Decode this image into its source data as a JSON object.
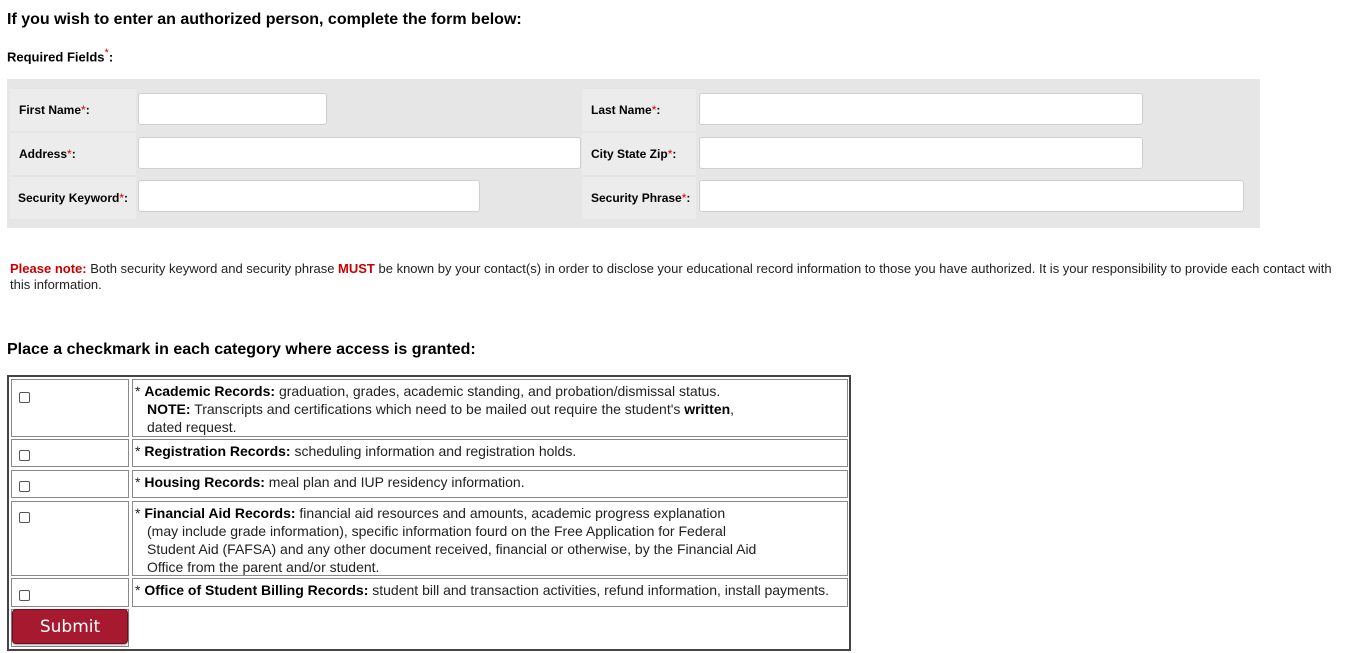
{
  "header": {
    "title": "If you wish to enter an authorized person, complete the form below:",
    "required_fields": "Required Fields",
    "asterisk": "*",
    "colon": ":"
  },
  "form": {
    "first_name_label": "First Name",
    "last_name_label": "Last Name",
    "address_label": "Address",
    "city_state_zip_label": "City State Zip",
    "security_keyword_label": "Security Keyword",
    "security_phrase_label": "Security Phrase",
    "first_name_value": "",
    "last_name_value": "",
    "address_value": "",
    "city_state_zip_value": "",
    "security_keyword_value": "",
    "security_phrase_value": ""
  },
  "note": {
    "prefix": "Please note:",
    "text_a": " Both security keyword and security phrase ",
    "must": "MUST",
    "text_b": " be known by your contact(s) in order to disclose your educational record information to those you have authorized. It is your responsibility to provide each contact with this information."
  },
  "categories": {
    "heading": "Place a checkmark in each category where access is granted:",
    "academic": {
      "title": "Academic Records:",
      "text": " graduation, grades, academic standing, and probation/dismissal status.",
      "note_label": "NOTE:",
      "note_text_a": " Transcripts and certifications which need to be mailed out require the student's ",
      "note_written": "written",
      "note_text_b": ",",
      "note_text_c": "dated request."
    },
    "registration": {
      "title": "Registration Records:",
      "text": " scheduling information and registration holds."
    },
    "housing": {
      "title": "Housing Records:",
      "text": " meal plan and IUP residency information."
    },
    "financial": {
      "title": "Financial Aid Records:",
      "line1": " financial aid resources and amounts, academic progress explanation",
      "line2": "(may include grade information), specific information fourd on the Free Application for Federal",
      "line3": "Student Aid (FAFSA) and any other document received, financial or otherwise, by the Financial Aid",
      "line4": "Office from the parent and/or student."
    },
    "billing": {
      "title": "Office of Student Billing Records:",
      "text": " student bill and transaction activities, refund information, install payments."
    }
  },
  "actions": {
    "submit_label": "Submit"
  },
  "colors": {
    "required_star": "#cc0000",
    "submit_bg": "#a6192e",
    "panel_bg": "#e6e6e6"
  }
}
